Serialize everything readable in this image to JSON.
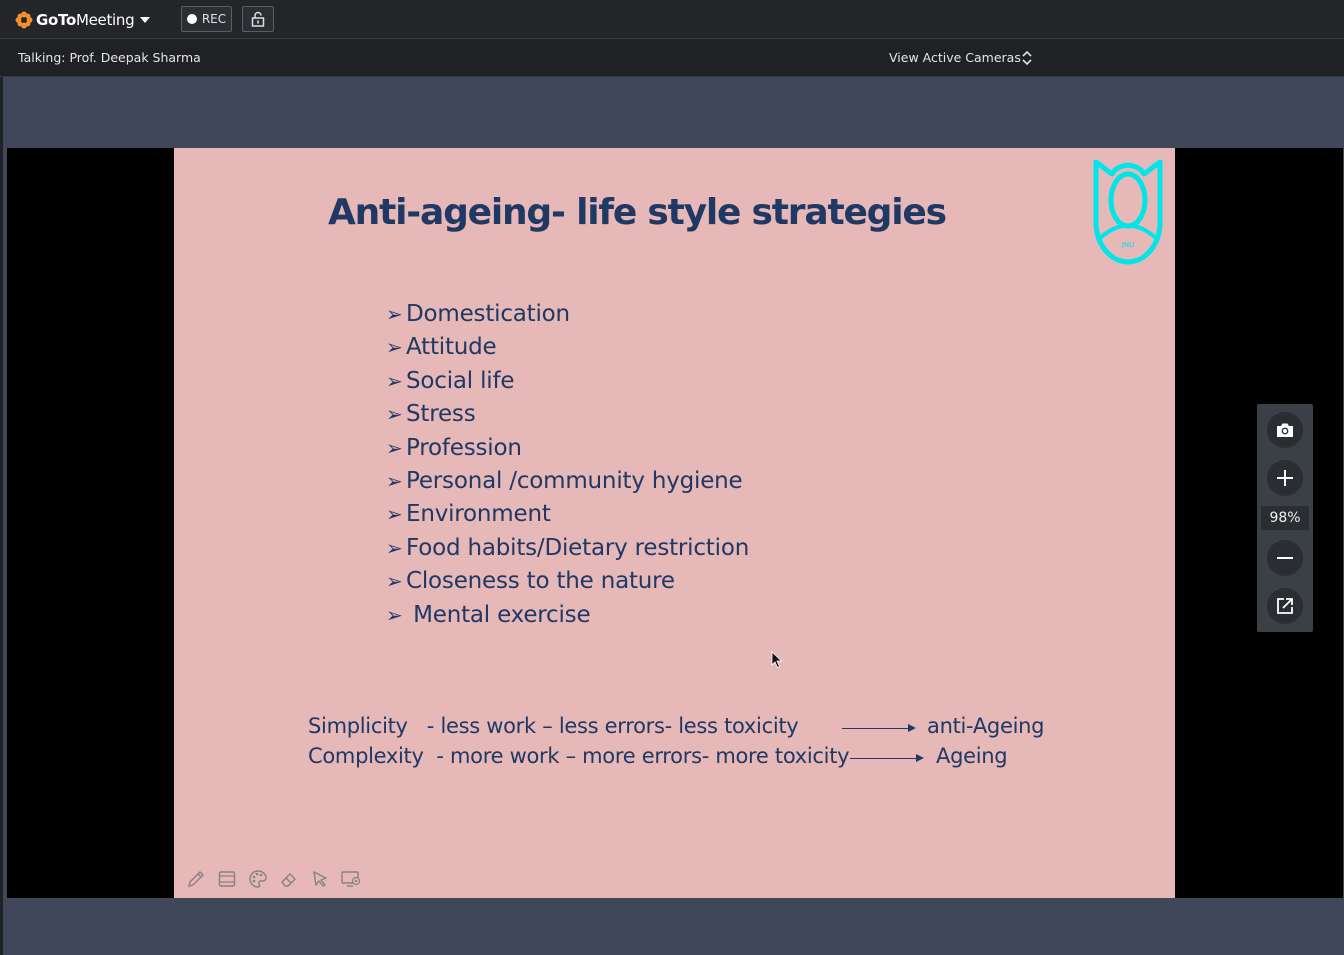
{
  "app": {
    "brand_goto": "GoTo",
    "brand_meeting": "Meeting",
    "rec_label": "REC"
  },
  "info": {
    "talking": "Talking: Prof. Deepak Sharma",
    "view_cameras": "View Active Cameras"
  },
  "slide": {
    "title": "Anti-ageing- life style strategies",
    "bullets": [
      "Domestication",
      "Attitude",
      "Social life",
      "Stress",
      "Profession",
      "Personal /community hygiene",
      "Environment",
      "Food habits/Dietary restriction",
      "Closeness to the nature",
      " Mental exercise"
    ],
    "simplicity_text": "Simplicity   - less work – less errors- less toxicity",
    "simplicity_result": "anti-Ageing",
    "complexity_text": "Complexity  - more work – more errors- more toxicity",
    "complexity_result": "Ageing",
    "logo_text": "JNU",
    "logo_color": "#00e5e8",
    "text_color": "#1f3864",
    "background_color": "#e6b8b7"
  },
  "zoom": {
    "value": "98%"
  },
  "icons": {
    "annotation_tools": [
      "pencil-icon",
      "highlighter-icon",
      "palette-icon",
      "eraser-icon",
      "pointer-icon",
      "screen-settings-icon"
    ],
    "zoom_controls": [
      "camera-icon",
      "plus-icon",
      "minus-icon",
      "pop-out-icon"
    ]
  },
  "colors": {
    "brand_orange": "#f68d2e",
    "stage_background": "#3f4759",
    "topbar_background": "#232529"
  }
}
